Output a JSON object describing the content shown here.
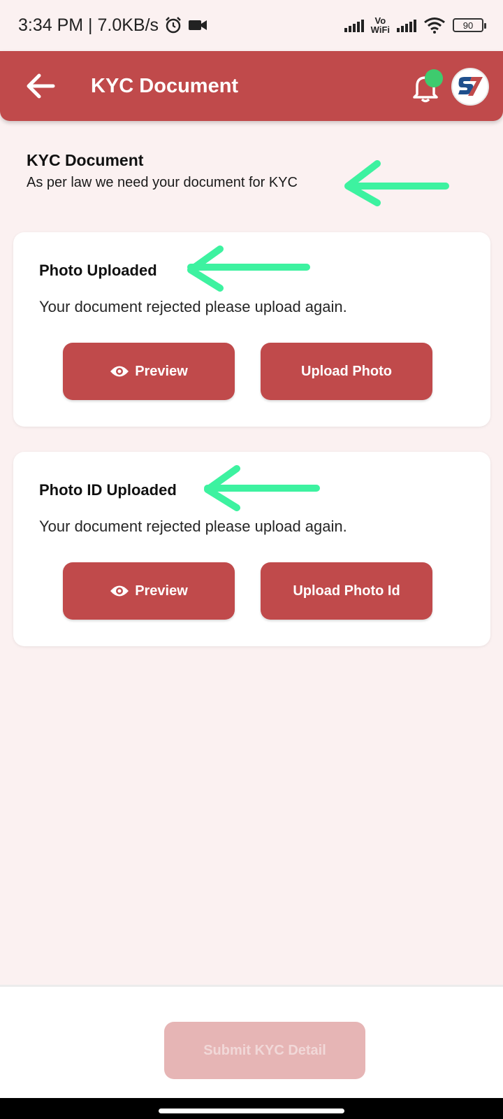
{
  "status_bar": {
    "time_speed": "3:34 PM | 7.0KB/s",
    "vowifi_top": "Vo",
    "vowifi_bottom": "WiFi",
    "battery": "90"
  },
  "app_bar": {
    "title": "KYC Document",
    "back_icon": "arrow-left-icon",
    "bell_icon": "bell-icon",
    "avatar_icon": "s7-logo"
  },
  "intro": {
    "title": "KYC Document",
    "subtitle": "As per law we need your document for KYC"
  },
  "cards": [
    {
      "title": "Photo Uploaded",
      "message": "Your document rejected please upload again.",
      "preview_label": "Preview",
      "upload_label": "Upload Photo"
    },
    {
      "title": "Photo ID Uploaded",
      "message": "Your document rejected please upload again.",
      "preview_label": "Preview",
      "upload_label": "Upload Photo Id"
    }
  ],
  "footer": {
    "submit_label": "Submit KYC Detail"
  },
  "colors": {
    "primary": "#c04a4b",
    "background": "#fbf1f1",
    "annotation_arrow": "#3df2a0",
    "notification_dot": "#3ecb6e",
    "submit_disabled": "#e6b5b5"
  }
}
